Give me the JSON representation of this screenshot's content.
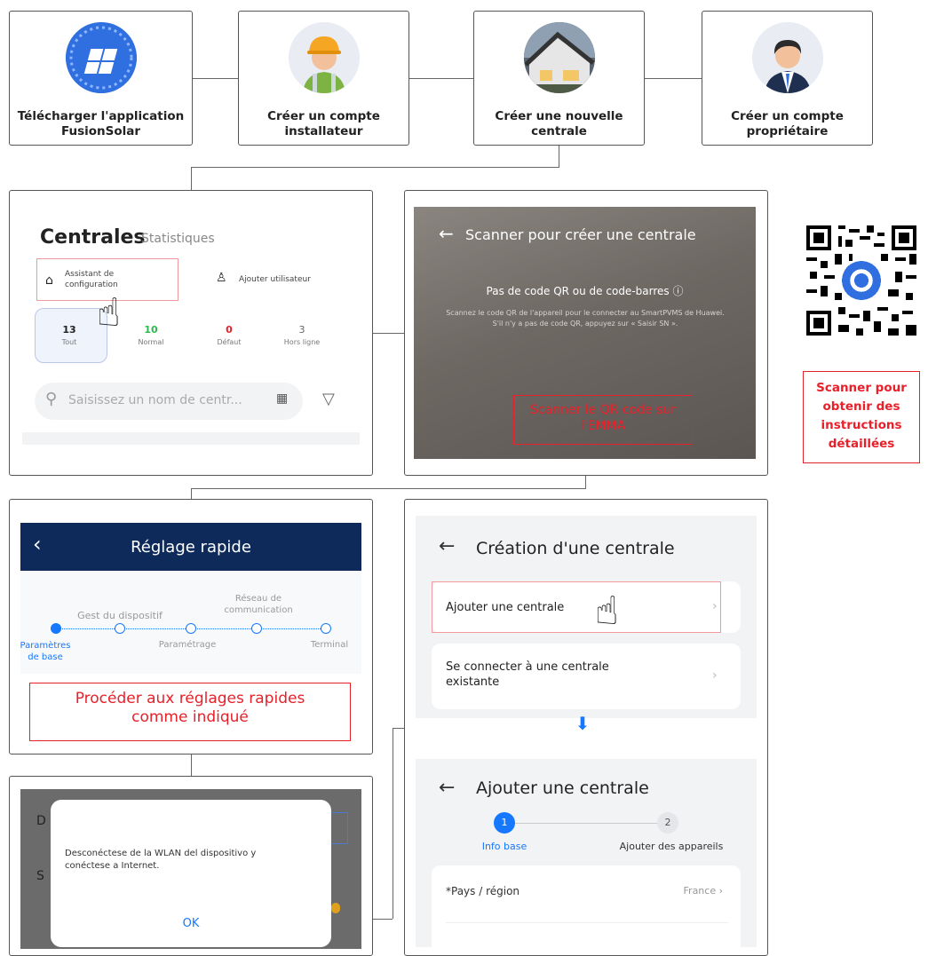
{
  "steps": [
    {
      "label_line1": "Télécharger l'application",
      "label_line2": "FusionSolar",
      "icon": "fusionsolar-app-icon"
    },
    {
      "label_line1": "Créer un compte",
      "label_line2": "installateur",
      "icon": "installer-avatar-icon"
    },
    {
      "label_line1": "Créer une nouvelle",
      "label_line2": "centrale",
      "icon": "house-icon"
    },
    {
      "label_line1": "Créer un compte",
      "label_line2": "propriétaire",
      "icon": "owner-avatar-icon"
    }
  ],
  "panel_centrales": {
    "title": "Centrales",
    "tab_stats": "Statistiques",
    "assistant_line1": "Assistant de",
    "assistant_line2": "configuration",
    "add_user": "Ajouter utilisateur",
    "stats": [
      {
        "value": "13",
        "label": "Tout",
        "color": "#222222"
      },
      {
        "value": "10",
        "label": "Normal",
        "color": "#2db84d"
      },
      {
        "value": "0",
        "label": "Défaut",
        "color": "#e8202a"
      },
      {
        "value": "3",
        "label": "Hors ligne",
        "color": "#666666"
      }
    ],
    "search_placeholder": "Saisissez un nom de centr..."
  },
  "panel_scan": {
    "title": "Scanner pour créer une centrale",
    "no_code": "Pas de code QR ou de code-barres",
    "instructions": "Scannez le code QR de l'appareil pour le connecter au SmartPVMS de Huawei. S'il n'y a pas de code QR, appuyez sur « Saisir SN ».",
    "callout_line1": "Scanner le QR code sur",
    "callout_line2": "l'EMMA"
  },
  "qr_callout": [
    "Scanner pour",
    "obtenir des",
    "instructions",
    "détaillées"
  ],
  "panel_quick": {
    "header": "Réglage rapide",
    "steps": [
      {
        "top": "",
        "bottom_line1": "Paramètres",
        "bottom_line2": "de base"
      },
      {
        "top": "Gest du dispositif",
        "bottom_line1": "",
        "bottom_line2": ""
      },
      {
        "top": "",
        "bottom_line1": "Paramétrage",
        "bottom_line2": ""
      },
      {
        "top_line1": "Réseau de",
        "top_line2": "communication",
        "bottom_line1": "",
        "bottom_line2": ""
      },
      {
        "top": "",
        "bottom_line1": "Terminal",
        "bottom_line2": ""
      }
    ],
    "callout_line1": "Procéder aux réglages rapides",
    "callout_line2": "comme indiqué"
  },
  "panel_dialog": {
    "bg_letter_1": "D",
    "bg_letter_2": "S",
    "message_line1": "Desconéctese de la WLAN del dispositivo y",
    "message_line2": "conéctese a Internet.",
    "ok": "OK"
  },
  "panel_creation": {
    "title": "Création d'une centrale",
    "option_add": "Ajouter une centrale",
    "option_connect_line1": "Se connecter à une centrale",
    "option_connect_line2": "existante",
    "title2": "Ajouter une centrale",
    "step1_num": "1",
    "step1_label": "Info base",
    "step2_num": "2",
    "step2_label": "Ajouter des appareils",
    "field_label": "*Pays / région",
    "field_value": "France"
  },
  "colors": {
    "accent": "#1677ff",
    "red": "#e8202a",
    "navy": "#0d2a5a"
  }
}
